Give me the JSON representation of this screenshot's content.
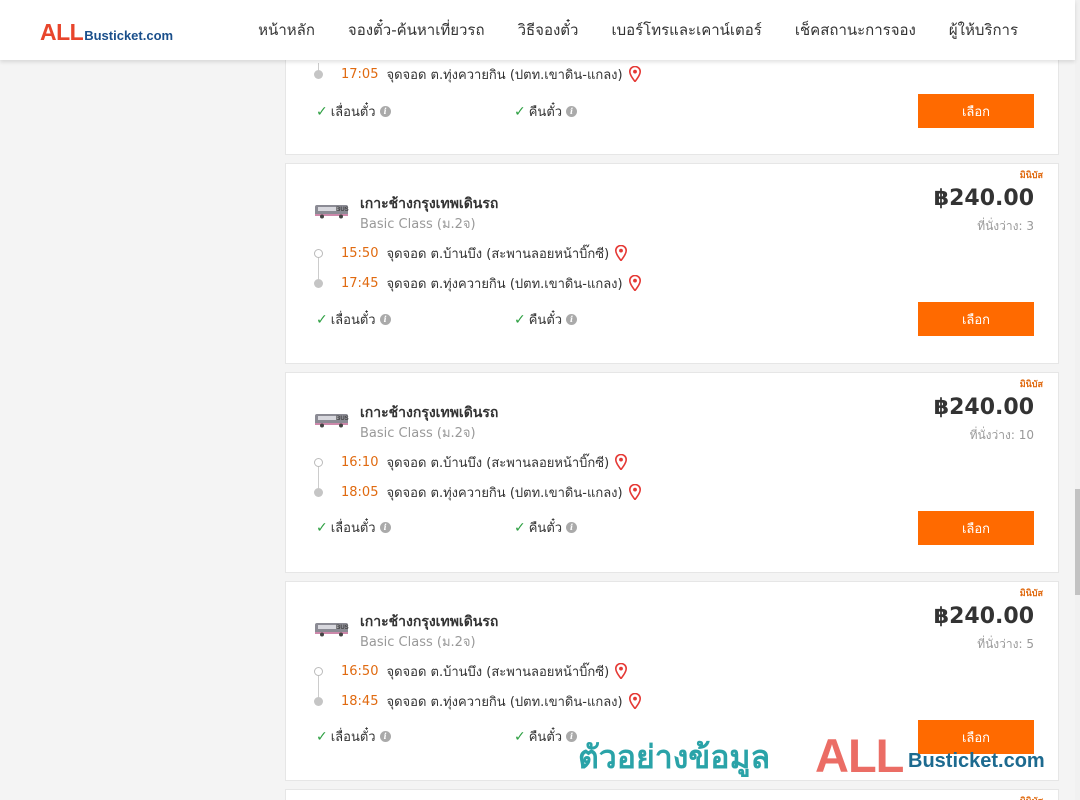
{
  "header": {
    "logo_all": "ALL",
    "logo_rest": "Busticket.com",
    "nav": [
      "หน้าหลัก",
      "จองตั๋ว-ค้นหาเที่ยวรถ",
      "วิธีจองตั๋ว",
      "เบอร์โทรและเคาน์เตอร์",
      "เช็คสถานะการจอง",
      "ผู้ให้บริการ"
    ]
  },
  "labels": {
    "reschedule": "เลื่อนตั๋ว",
    "refund": "คืนตั๋ว",
    "select": "เลือก",
    "badge": "มินิบัส"
  },
  "top_card": {
    "arrive_time": "17:05",
    "arrive_place": "จุดจอด ต.ทุ่งควายกิน (ปตท.เขาดิน-แกลง)"
  },
  "trips": [
    {
      "operator": "เกาะช้างกรุงเทพเดินรถ",
      "class": "Basic Class (ม.2จ)",
      "price": "฿240.00",
      "seats": "ที่นั่งว่าง: 3",
      "depart_time": "15:50",
      "depart_place": "จุดจอด ต.บ้านบึง (สะพานลอยหน้าบิ๊กซี)",
      "arrive_time": "17:45",
      "arrive_place": "จุดจอด ต.ทุ่งควายกิน (ปตท.เขาดิน-แกลง)"
    },
    {
      "operator": "เกาะช้างกรุงเทพเดินรถ",
      "class": "Basic Class (ม.2จ)",
      "price": "฿240.00",
      "seats": "ที่นั่งว่าง: 10",
      "depart_time": "16:10",
      "depart_place": "จุดจอด ต.บ้านบึง (สะพานลอยหน้าบิ๊กซี)",
      "arrive_time": "18:05",
      "arrive_place": "จุดจอด ต.ทุ่งควายกิน (ปตท.เขาดิน-แกลง)"
    },
    {
      "operator": "เกาะช้างกรุงเทพเดินรถ",
      "class": "Basic Class (ม.2จ)",
      "price": "฿240.00",
      "seats": "ที่นั่งว่าง: 5",
      "depart_time": "16:50",
      "depart_place": "จุดจอด ต.บ้านบึง (สะพานลอยหน้าบิ๊กซี)",
      "arrive_time": "18:45",
      "arrive_place": "จุดจอด ต.ทุ่งควายกิน (ปตท.เขาดิน-แกลง)"
    }
  ],
  "watermark": {
    "text": "ตัวอย่างข้อมูล",
    "all": "ALL",
    "busticket": "Busticket.com"
  },
  "colors": {
    "accent": "#ff6a00",
    "time": "#e06a10",
    "check": "#2ea043",
    "pin": "#e53935"
  }
}
